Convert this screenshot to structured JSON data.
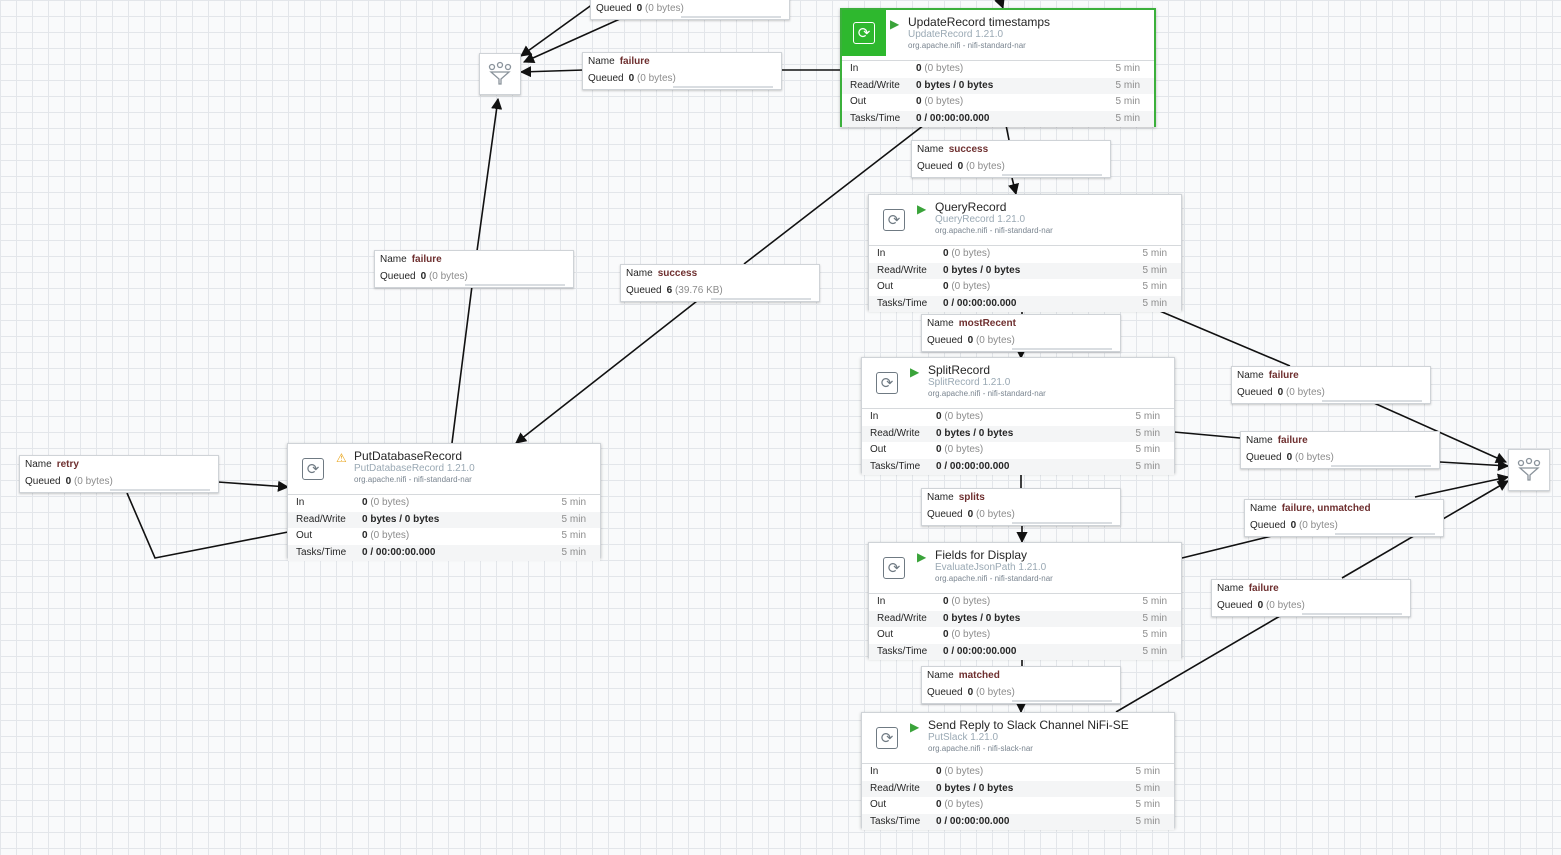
{
  "processors": [
    {
      "name": "UpdateRecord timestamps",
      "type": "UpdateRecord 1.21.0",
      "bundle": "org.apache.nifi - nifi-standard-nar",
      "status": "running",
      "selected": true,
      "stats": [
        {
          "label": "In",
          "value": "0",
          "extra": "(0 bytes)",
          "time": "5 min"
        },
        {
          "label": "Read/Write",
          "value": "0 bytes / 0 bytes",
          "extra": "",
          "time": "5 min"
        },
        {
          "label": "Out",
          "value": "0",
          "extra": "(0 bytes)",
          "time": "5 min"
        },
        {
          "label": "Tasks/Time",
          "value": "0 / 00:00:00.000",
          "extra": "",
          "time": "5 min"
        }
      ]
    },
    {
      "name": "QueryRecord",
      "type": "QueryRecord 1.21.0",
      "bundle": "org.apache.nifi - nifi-standard-nar",
      "status": "running",
      "selected": false,
      "stats": [
        {
          "label": "In",
          "value": "0",
          "extra": "(0 bytes)",
          "time": "5 min"
        },
        {
          "label": "Read/Write",
          "value": "0 bytes / 0 bytes",
          "extra": "",
          "time": "5 min"
        },
        {
          "label": "Out",
          "value": "0",
          "extra": "(0 bytes)",
          "time": "5 min"
        },
        {
          "label": "Tasks/Time",
          "value": "0 / 00:00:00.000",
          "extra": "",
          "time": "5 min"
        }
      ]
    },
    {
      "name": "SplitRecord",
      "type": "SplitRecord 1.21.0",
      "bundle": "org.apache.nifi - nifi-standard-nar",
      "status": "running",
      "selected": false,
      "stats": [
        {
          "label": "In",
          "value": "0",
          "extra": "(0 bytes)",
          "time": "5 min"
        },
        {
          "label": "Read/Write",
          "value": "0 bytes / 0 bytes",
          "extra": "",
          "time": "5 min"
        },
        {
          "label": "Out",
          "value": "0",
          "extra": "(0 bytes)",
          "time": "5 min"
        },
        {
          "label": "Tasks/Time",
          "value": "0 / 00:00:00.000",
          "extra": "",
          "time": "5 min"
        }
      ]
    },
    {
      "name": "Fields for Display",
      "type": "EvaluateJsonPath 1.21.0",
      "bundle": "org.apache.nifi - nifi-standard-nar",
      "status": "running",
      "selected": false,
      "stats": [
        {
          "label": "In",
          "value": "0",
          "extra": "(0 bytes)",
          "time": "5 min"
        },
        {
          "label": "Read/Write",
          "value": "0 bytes / 0 bytes",
          "extra": "",
          "time": "5 min"
        },
        {
          "label": "Out",
          "value": "0",
          "extra": "(0 bytes)",
          "time": "5 min"
        },
        {
          "label": "Tasks/Time",
          "value": "0 / 00:00:00.000",
          "extra": "",
          "time": "5 min"
        }
      ]
    },
    {
      "name": "Send Reply to Slack Channel NiFi-SE",
      "type": "PutSlack 1.21.0",
      "bundle": "org.apache.nifi - nifi-slack-nar",
      "status": "running",
      "selected": false,
      "stats": [
        {
          "label": "In",
          "value": "0",
          "extra": "(0 bytes)",
          "time": "5 min"
        },
        {
          "label": "Read/Write",
          "value": "0 bytes / 0 bytes",
          "extra": "",
          "time": "5 min"
        },
        {
          "label": "Out",
          "value": "0",
          "extra": "(0 bytes)",
          "time": "5 min"
        },
        {
          "label": "Tasks/Time",
          "value": "0 / 00:00:00.000",
          "extra": "",
          "time": "5 min"
        }
      ]
    },
    {
      "name": "PutDatabaseRecord",
      "type": "PutDatabaseRecord 1.21.0",
      "bundle": "org.apache.nifi - nifi-standard-nar",
      "status": "invalid",
      "selected": false,
      "stats": [
        {
          "label": "In",
          "value": "0",
          "extra": "(0 bytes)",
          "time": "5 min"
        },
        {
          "label": "Read/Write",
          "value": "0 bytes / 0 bytes",
          "extra": "",
          "time": "5 min"
        },
        {
          "label": "Out",
          "value": "0",
          "extra": "(0 bytes)",
          "time": "5 min"
        },
        {
          "label": "Tasks/Time",
          "value": "0 / 00:00:00.000",
          "extra": "",
          "time": "5 min"
        }
      ]
    }
  ],
  "connections": [
    {
      "id": "c-top",
      "name": "",
      "queued": "0",
      "size": "(0 bytes)"
    },
    {
      "id": "c-upd-failure",
      "name": "failure",
      "queued": "0",
      "size": "(0 bytes)"
    },
    {
      "id": "c-upd-success",
      "name": "success",
      "queued": "0",
      "size": "(0 bytes)"
    },
    {
      "id": "c-put-failure",
      "name": "failure",
      "queued": "0",
      "size": "(0 bytes)"
    },
    {
      "id": "c-success-queued",
      "name": "success",
      "queued": "6",
      "size": "(39.76 KB)"
    },
    {
      "id": "c-mostrecent",
      "name": "mostRecent",
      "queued": "0",
      "size": "(0 bytes)"
    },
    {
      "id": "c-query-failure",
      "name": "failure",
      "queued": "0",
      "size": "(0 bytes)"
    },
    {
      "id": "c-split-failure",
      "name": "failure",
      "queued": "0",
      "size": "(0 bytes)"
    },
    {
      "id": "c-splits",
      "name": "splits",
      "queued": "0",
      "size": "(0 bytes)"
    },
    {
      "id": "c-eval-failure",
      "name": "failure, unmatched",
      "queued": "0",
      "size": "(0 bytes)"
    },
    {
      "id": "c-slack-failure",
      "name": "failure",
      "queued": "0",
      "size": "(0 bytes)"
    },
    {
      "id": "c-matched",
      "name": "matched",
      "queued": "0",
      "size": "(0 bytes)"
    },
    {
      "id": "c-retry",
      "name": "retry",
      "queued": "0",
      "size": "(0 bytes)"
    }
  ],
  "labels": {
    "name": "Name",
    "queued": "Queued"
  },
  "funnels": [
    {
      "id": "funnel-left",
      "icon": "funnel-icon"
    },
    {
      "id": "funnel-right",
      "icon": "funnel-icon"
    }
  ],
  "glyphs": {
    "refresh": "⟳",
    "play": "▶",
    "warning": "⚠"
  },
  "colors": {
    "running": "#3aa33a",
    "warning": "#e8a317",
    "selected": "#2eb82e",
    "queue_value": "#6e2f2f"
  }
}
